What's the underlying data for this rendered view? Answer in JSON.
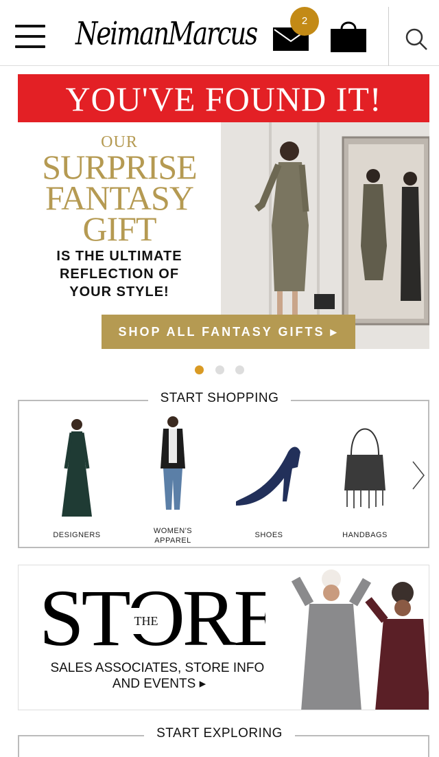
{
  "header": {
    "logo": "NeimanMarcus",
    "notification_count": "2",
    "icons": [
      "menu-icon",
      "mail-icon",
      "shopping-bag-icon",
      "search-icon"
    ]
  },
  "hero": {
    "banner": "YOU'VE FOUND IT!",
    "our": "OUR",
    "headline_1": "SURPRISE",
    "headline_2": "FANTASY",
    "headline_3": "GIFT",
    "tagline_1": "IS THE ULTIMATE",
    "tagline_2": "REFLECTION OF",
    "tagline_3": "YOUR STYLE!",
    "cta": "SHOP ALL FANTASY GIFTS ▸"
  },
  "carousel": {
    "dot_count": 3,
    "active_index": 0
  },
  "start_shopping": {
    "title": "START SHOPPING",
    "items": [
      {
        "label": "DESIGNERS"
      },
      {
        "label_1": "WOMEN'S",
        "label_2": "APPAREL"
      },
      {
        "label": "SHOES"
      },
      {
        "label": "HANDBAGS"
      }
    ]
  },
  "store": {
    "word": "STORE",
    "the": "THE",
    "text_1": "SALES ASSOCIATES, STORE INFO,",
    "text_2": "AND EVENTS ▸"
  },
  "start_exploring": {
    "title": "START EXPLORING"
  },
  "colors": {
    "accent_gold": "#b59a52",
    "banner_red": "#e32025",
    "badge_gold": "#c38a16",
    "dot_active": "#d99a24"
  }
}
